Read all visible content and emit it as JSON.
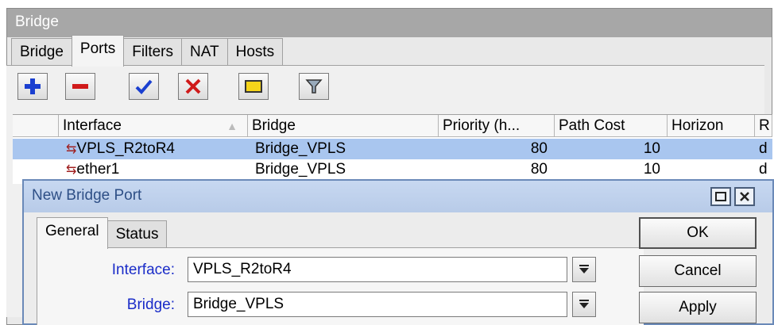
{
  "window": {
    "title": "Bridge"
  },
  "tabs": [
    {
      "label": "Bridge"
    },
    {
      "label": "Ports"
    },
    {
      "label": "Filters"
    },
    {
      "label": "NAT"
    },
    {
      "label": "Hosts"
    }
  ],
  "toolbar": {
    "add": "plus-icon",
    "remove": "minus-icon",
    "enable": "check-icon",
    "disable": "x-icon",
    "comment": "comment-icon",
    "filter": "filter-icon"
  },
  "table": {
    "columns": [
      "Interface",
      "Bridge",
      "Priority (h...",
      "Path Cost",
      "Horizon",
      "R"
    ],
    "rows": [
      {
        "interface": "VPLS_R2toR4",
        "bridge": "Bridge_VPLS",
        "priority": "80",
        "path_cost": "10",
        "horizon": "",
        "r": "d",
        "selected": true
      },
      {
        "interface": "ether1",
        "bridge": "Bridge_VPLS",
        "priority": "80",
        "path_cost": "10",
        "horizon": "",
        "r": "d",
        "selected": false
      }
    ]
  },
  "dialog": {
    "title": "New Bridge Port",
    "tabs": [
      {
        "label": "General"
      },
      {
        "label": "Status"
      }
    ],
    "fields": {
      "interface_label": "Interface:",
      "interface_value": "VPLS_R2toR4",
      "bridge_label": "Bridge:",
      "bridge_value": "Bridge_VPLS"
    },
    "buttons": {
      "ok": "OK",
      "cancel": "Cancel",
      "apply": "Apply"
    }
  },
  "colors": {
    "selected_row": "#a9c6ef",
    "field_label": "#1a2cc8",
    "dialog_title_text": "#2e4f86"
  }
}
